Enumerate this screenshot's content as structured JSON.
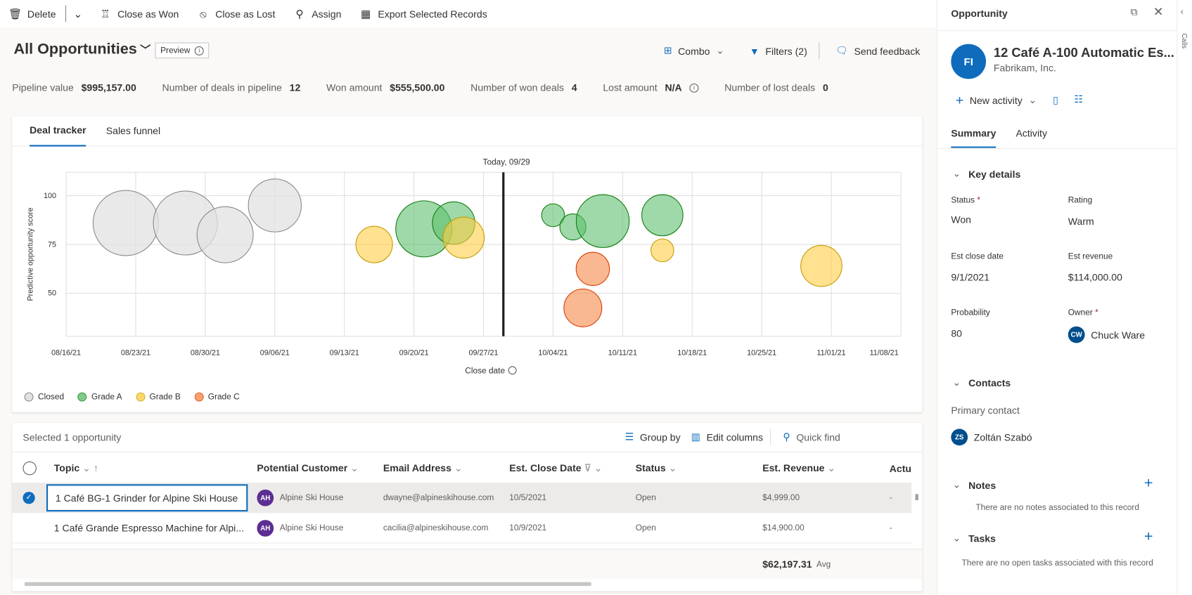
{
  "commands": {
    "delete": "Delete",
    "close_won": "Close as Won",
    "close_lost": "Close as Lost",
    "assign": "Assign",
    "export": "Export Selected Records"
  },
  "header": {
    "title": "All Opportunities",
    "preview": "Preview",
    "combo": "Combo",
    "filters": "Filters (2)",
    "feedback": "Send feedback"
  },
  "kpis": [
    {
      "label": "Pipeline value",
      "value": "$995,157.00"
    },
    {
      "label": "Number of deals in pipeline",
      "value": "12"
    },
    {
      "label": "Won amount",
      "value": "$555,500.00"
    },
    {
      "label": "Number of won deals",
      "value": "4"
    },
    {
      "label": "Lost amount",
      "value": "N/A"
    },
    {
      "label": "Number of lost deals",
      "value": "0"
    }
  ],
  "chart_tabs": [
    "Deal tracker",
    "Sales funnel"
  ],
  "chart_data": {
    "type": "scatter",
    "subtype": "bubble",
    "today_label": "Today, 09/29",
    "today": "2021-09-29",
    "xlabel": "Close date",
    "ylabel": "Predictive opportunity score",
    "x_ticks": [
      "08/16/21",
      "08/23/21",
      "08/30/21",
      "09/06/21",
      "09/13/21",
      "09/20/21",
      "09/27/21",
      "10/04/21",
      "10/11/21",
      "10/18/21",
      "10/25/21",
      "11/01/21",
      "11/08/21"
    ],
    "y_ticks": [
      "100",
      "75",
      "50"
    ],
    "xlim": [
      "2021-08-16",
      "2021-11-08"
    ],
    "ylim": [
      28,
      112
    ],
    "grid": true,
    "legend_position": "bottom-left",
    "series": [
      {
        "name": "Closed",
        "fill": "#e1e1e1",
        "stroke": "#8a8886",
        "points": [
          {
            "date": "2021-08-22",
            "score": 86,
            "relative_size": 1.0
          },
          {
            "date": "2021-08-28",
            "score": 86,
            "relative_size": 0.98
          },
          {
            "date": "2021-09-01",
            "score": 80,
            "relative_size": 0.86
          },
          {
            "date": "2021-09-06",
            "score": 95,
            "relative_size": 0.81
          }
        ]
      },
      {
        "name": "Grade A",
        "fill": "#5fbf6f",
        "stroke": "#107c10",
        "points": [
          {
            "date": "2021-09-21",
            "score": 83,
            "relative_size": 0.86
          },
          {
            "date": "2021-09-24",
            "score": 86,
            "relative_size": 0.65
          },
          {
            "date": "2021-10-04",
            "score": 90,
            "relative_size": 0.35
          },
          {
            "date": "2021-10-06",
            "score": 84,
            "relative_size": 0.4
          },
          {
            "date": "2021-10-09",
            "score": 87,
            "relative_size": 0.81
          },
          {
            "date": "2021-10-15",
            "score": 90,
            "relative_size": 0.63
          }
        ]
      },
      {
        "name": "Grade B",
        "fill": "#ffcd45",
        "stroke": "#c19c00",
        "points": [
          {
            "date": "2021-09-16",
            "score": 75,
            "relative_size": 0.56
          },
          {
            "date": "2021-09-25",
            "score": 78.5,
            "relative_size": 0.63
          },
          {
            "date": "2021-10-15",
            "score": 72,
            "relative_size": 0.35
          },
          {
            "date": "2021-10-31",
            "score": 64,
            "relative_size": 0.63
          }
        ]
      },
      {
        "name": "Grade C",
        "fill": "#f7894a",
        "stroke": "#d83b01",
        "points": [
          {
            "date": "2021-10-08",
            "score": 62.5,
            "relative_size": 0.51
          },
          {
            "date": "2021-10-07",
            "score": 42.5,
            "relative_size": 0.58
          }
        ]
      }
    ]
  },
  "grid": {
    "selected_label": "Selected 1 opportunity",
    "group_by": "Group by",
    "edit_columns": "Edit columns",
    "quick_find": "Quick find",
    "columns": [
      "Topic",
      "Potential Customer",
      "Email Address",
      "Est. Close Date",
      "Status",
      "Est. Revenue",
      "Actual C"
    ],
    "rows": [
      {
        "topic": "1 Café BG-1 Grinder for Alpine Ski House",
        "initials": "AH",
        "customer": "Alpine Ski House",
        "email": "dwayne@alpineskihouse.com",
        "close": "10/5/2021",
        "status": "Open",
        "revenue": "$4,999.00",
        "actual": "-"
      },
      {
        "topic": "1 Café Grande Espresso Machine for Alpi...",
        "initials": "AH",
        "customer": "Alpine Ski House",
        "email": "cacilia@alpineskihouse.com",
        "close": "10/9/2021",
        "status": "Open",
        "revenue": "$14,900.00",
        "actual": "-"
      }
    ],
    "footer_value": "$62,197.31",
    "footer_agg": "Avg"
  },
  "panel": {
    "header": "Opportunity",
    "initials": "FI",
    "name": "12 Café A-100 Automatic Es...",
    "account": "Fabrikam, Inc.",
    "new_activity": "New activity",
    "tabs": [
      "Summary",
      "Activity"
    ],
    "key_details": "Key details",
    "status_label": "Status",
    "status": "Won",
    "rating_label": "Rating",
    "rating": "Warm",
    "close_label": "Est close date",
    "close": "9/1/2021",
    "revenue_label": "Est revenue",
    "revenue": "$114,000.00",
    "prob_label": "Probability",
    "prob": "80",
    "owner_label": "Owner",
    "owner_initials": "CW",
    "owner": "Chuck Ware",
    "contacts": "Contacts",
    "primary_label": "Primary contact",
    "contact_initials": "ZS",
    "contact": "Zoltán Szabó",
    "notes": "Notes",
    "notes_empty": "There are no notes associated to this record",
    "tasks": "Tasks",
    "tasks_empty": "There are no open tasks associated with this record",
    "side_tab": "Calls"
  }
}
